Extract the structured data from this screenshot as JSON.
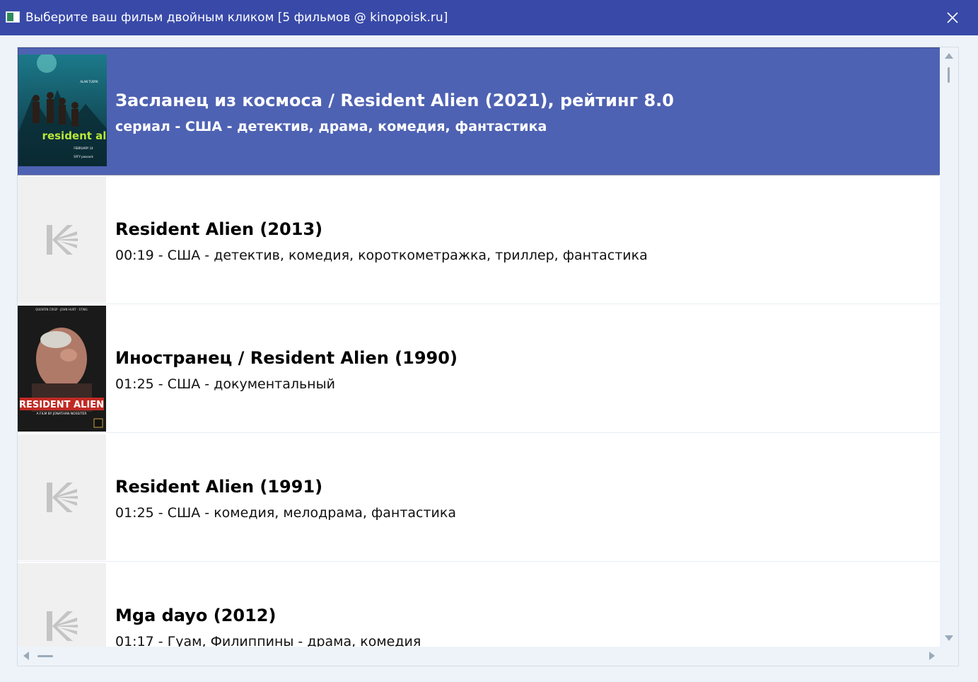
{
  "window": {
    "title": "Выберите ваш фильм двойным кликом [5 фильмов @ kinopoisk.ru]",
    "app_icon": "window-app-icon",
    "close_icon": "close-icon"
  },
  "colors": {
    "titlebar": "#3849a8",
    "selection": "#4e62b3",
    "background": "#eef3f9"
  },
  "films": [
    {
      "title": "Засланец из космоса / Resident Alien (2021), рейтинг 8.0",
      "subtitle": "сериал - США - детектив, драма, комедия, фантастика",
      "poster": "poster-image",
      "poster_text": {
        "top": "ALAN TUDYK",
        "brand": "resident alien",
        "date": "FEBRUARY 14",
        "footer": "SYFY peacock"
      },
      "selected": true
    },
    {
      "title": "Resident Alien (2013)",
      "subtitle": "00:19 - США - детектив, комедия, короткометражка, триллер, фантастика",
      "poster": "kinopoisk-placeholder-icon",
      "selected": false
    },
    {
      "title": "Иностранец / Resident Alien (1990)",
      "subtitle": "01:25 - США - документальный",
      "poster": "poster-image",
      "poster_text": {
        "top": "QUENTIN CRISP · JOHN HURT · STING",
        "brand": "RESIDENT ALIEN",
        "byline": "A FILM BY JONATHAN NOSSITER"
      },
      "selected": false
    },
    {
      "title": "Resident Alien (1991)",
      "subtitle": "01:25 - США - комедия, мелодрама, фантастика",
      "poster": "kinopoisk-placeholder-icon",
      "selected": false
    },
    {
      "title": "Mga dayo (2012)",
      "subtitle": "01:17 - Гуам, Филиппины - драма, комедия",
      "poster": "kinopoisk-placeholder-icon",
      "selected": false
    }
  ]
}
